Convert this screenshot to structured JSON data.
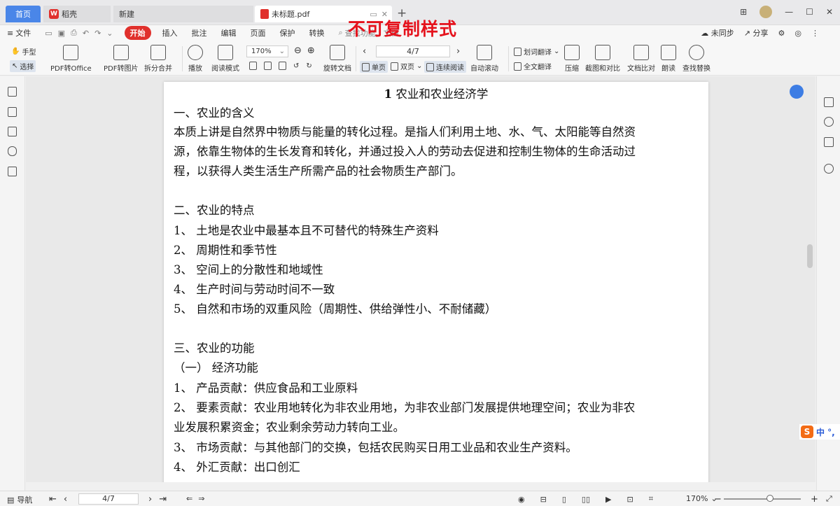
{
  "tabs": {
    "home": "首页",
    "wps": "稻壳",
    "new": "新建",
    "doc": "未标题.pdf",
    "wps_logo_letter": "W"
  },
  "watermark": "不可复制样式",
  "menu": {
    "file": "文件",
    "start": "开始",
    "insert": "插入",
    "annotate": "批注",
    "edit": "编辑",
    "page": "页面",
    "protect": "保护",
    "convert": "转换",
    "search": "查找功能、文档",
    "unsync": "未同步",
    "share": "分享"
  },
  "toolbar": {
    "hand": "手型",
    "select": "选择",
    "pdf_to_office": "PDF转Office",
    "pdf_to_image": "PDF转图片",
    "split_merge": "拆分合并",
    "play": "播放",
    "read_mode": "阅读模式",
    "zoom": "170%",
    "rotate_doc": "旋转文档",
    "page_indicator": "4/7",
    "single_page": "单页",
    "double_page": "双页",
    "continuous": "连续阅读",
    "auto_scroll": "自动滚动",
    "word_translate": "划词翻译",
    "full_translate": "全文翻译",
    "compress": "压缩",
    "screenshot_compare": "截图和对比",
    "doc_compare": "文档比对",
    "read_aloud": "朗读",
    "find_replace": "查找替换"
  },
  "document": {
    "title_num": "1",
    "title": "农业和农业经济学",
    "lines": [
      "一、农业的含义",
      "本质上讲是自然界中物质与能量的转化过程。是指人们利用土地、水、气、太阳能等自然资",
      "源，依靠生物体的生长发育和转化，并通过投入人的劳动去促进和控制生物体的生命活动过",
      "程，以获得人类生活生产所需产品的社会物质生产部门。",
      "二、农业的特点",
      "1、  土地是农业中最基本且不可替代的特殊生产资料",
      "2、  周期性和季节性",
      "3、  空间上的分散性和地域性",
      "4、  生产时间与劳动时间不一致",
      "5、  自然和市场的双重风险（周期性、供给弹性小、不耐储藏）",
      "三、农业的功能",
      "（一）  经济功能",
      "1、  产品贡献：供应食品和工业原料",
      "2、  要素贡献：农业用地转化为非农业用地，为非农业部门发展提供地理空间；农业为非农",
      "业发展积累资金；农业剩余劳动力转向工业。",
      "3、  市场贡献：与其他部门的交换，包括农民购买日用工业品和农业生产资料。",
      "4、  外汇贡献：出口创汇"
    ]
  },
  "statusbar": {
    "nav": "导航",
    "page": "4/7",
    "zoom": "170%"
  },
  "ime": {
    "logo": "S",
    "lang": "中 °,"
  }
}
